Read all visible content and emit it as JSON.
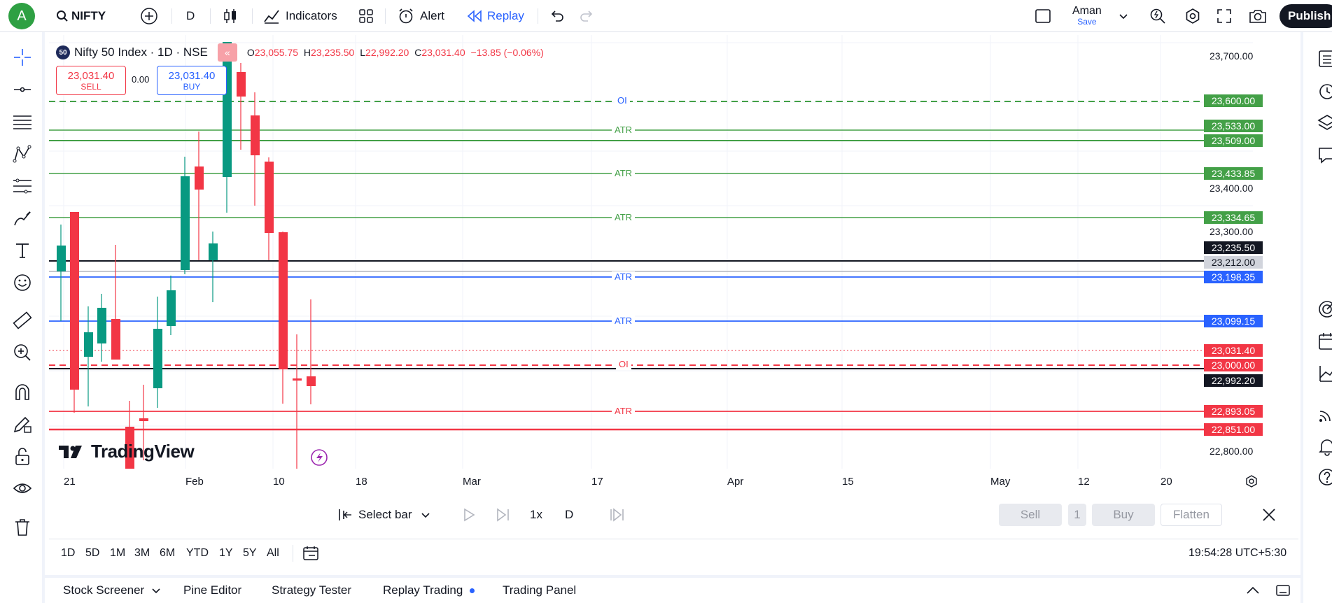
{
  "topbar": {
    "avatar_letter": "A",
    "symbol": "NIFTY",
    "interval": "D",
    "indicators_label": "Indicators",
    "alert_label": "Alert",
    "replay_label": "Replay",
    "user_name": "Aman",
    "save_label": "Save",
    "publish_label": "Publish"
  },
  "legend": {
    "badge": "50",
    "title": "Nifty 50 Index · 1D · NSE",
    "o_label": "O",
    "o_value": "23,055.75",
    "h_label": "H",
    "h_value": "23,235.50",
    "l_label": "L",
    "l_value": "22,992.20",
    "c_label": "C",
    "c_value": "23,031.40",
    "change": "−13.85 (−0.06%)",
    "sell_price": "23,031.40",
    "sell_label": "SELL",
    "spread": "0.00",
    "buy_price": "23,031.40",
    "buy_label": "BUY"
  },
  "logo_text": "TradingView",
  "price_axis": [
    "23,700.00",
    "23,400.00",
    "23,300.00",
    "22,800.00"
  ],
  "price_tags": [
    {
      "text": "23,600.00",
      "color": "#43a047"
    },
    {
      "text": "23,533.00",
      "color": "#43a047"
    },
    {
      "text": "23,509.00",
      "color": "#43a047"
    },
    {
      "text": "23,433.85",
      "color": "#43a047"
    },
    {
      "text": "23,334.65",
      "color": "#43a047"
    },
    {
      "text": "23,235.50",
      "color": "#131722"
    },
    {
      "text": "23,212.00",
      "color": "#d1d4dc"
    },
    {
      "text": "23,198.35",
      "color": "#2962ff"
    },
    {
      "text": "23,099.15",
      "color": "#2962ff"
    },
    {
      "text": "23,031.40",
      "color": "#f23645"
    },
    {
      "text": "23,000.00",
      "color": "#f23645"
    },
    {
      "text": "22,992.20",
      "color": "#131722"
    },
    {
      "text": "22,893.05",
      "color": "#f23645"
    },
    {
      "text": "22,851.00",
      "color": "#f23645"
    }
  ],
  "line_labels": {
    "oi_top": "OI",
    "atr1": "ATR",
    "atr2": "ATR",
    "atr3": "ATR",
    "atr4": "ATR",
    "atr5": "ATR",
    "oi_bottom": "OI",
    "atr6": "ATR"
  },
  "time_axis": [
    "21",
    "Feb",
    "10",
    "18",
    "Mar",
    "17",
    "Apr",
    "15",
    "May",
    "12",
    "20"
  ],
  "replay": {
    "select_bar": "Select bar",
    "speed": "1x",
    "interval": "D",
    "sell": "Sell",
    "qty": "1",
    "buy": "Buy",
    "flatten": "Flatten"
  },
  "ranges": [
    "1D",
    "5D",
    "1M",
    "3M",
    "6M",
    "YTD",
    "1Y",
    "5Y",
    "All"
  ],
  "clock": "19:54:28 UTC+5:30",
  "bottom_tabs": [
    "Stock Screener",
    "Pine Editor",
    "Strategy Tester",
    "Replay Trading",
    "Trading Panel"
  ],
  "colors": {
    "up": "#089981",
    "down": "#f23645",
    "accent": "#2962ff",
    "green_line": "#43a047"
  }
}
